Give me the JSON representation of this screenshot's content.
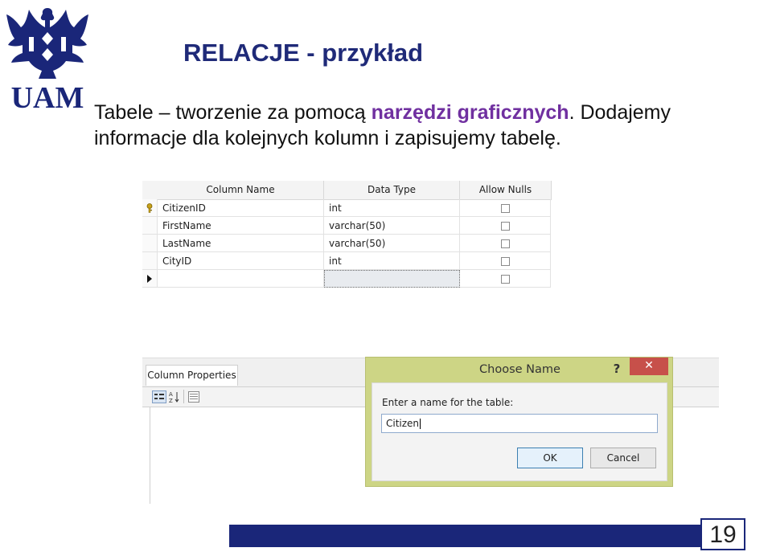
{
  "header": {
    "title": "RELACJE - przykład"
  },
  "logo": {
    "text": "UAM"
  },
  "description": {
    "part1": "Tabele – tworzenie za pomocą ",
    "highlight": "narzędzi graficznych",
    "part2": ". Dodajemy informacje dla kolejnych kolumn i zapisujemy tabelę."
  },
  "table_designer": {
    "headers": [
      "Column Name",
      "Data Type",
      "Allow Nulls"
    ],
    "rows": [
      {
        "name": "CitizenID",
        "type": "int",
        "key": true
      },
      {
        "name": "FirstName",
        "type": "varchar(50)",
        "key": false
      },
      {
        "name": "LastName",
        "type": "varchar(50)",
        "key": false
      },
      {
        "name": "CityID",
        "type": "int",
        "key": false
      },
      {
        "name": "",
        "type": "",
        "key": false
      }
    ]
  },
  "properties_pane": {
    "tab_label": "Column Properties"
  },
  "dialog": {
    "title": "Choose Name",
    "help_glyph": "?",
    "close_glyph": "✕",
    "prompt": "Enter a name for the table:",
    "value": "Citizen",
    "ok_label": "OK",
    "cancel_label": "Cancel"
  },
  "footer": {
    "page_number": "19"
  },
  "colors": {
    "title": "#1f2a78",
    "highlight": "#7030a0",
    "footer_bar": "#1a2679",
    "dialog_frame": "#cdd585",
    "close_button": "#c7504a"
  }
}
